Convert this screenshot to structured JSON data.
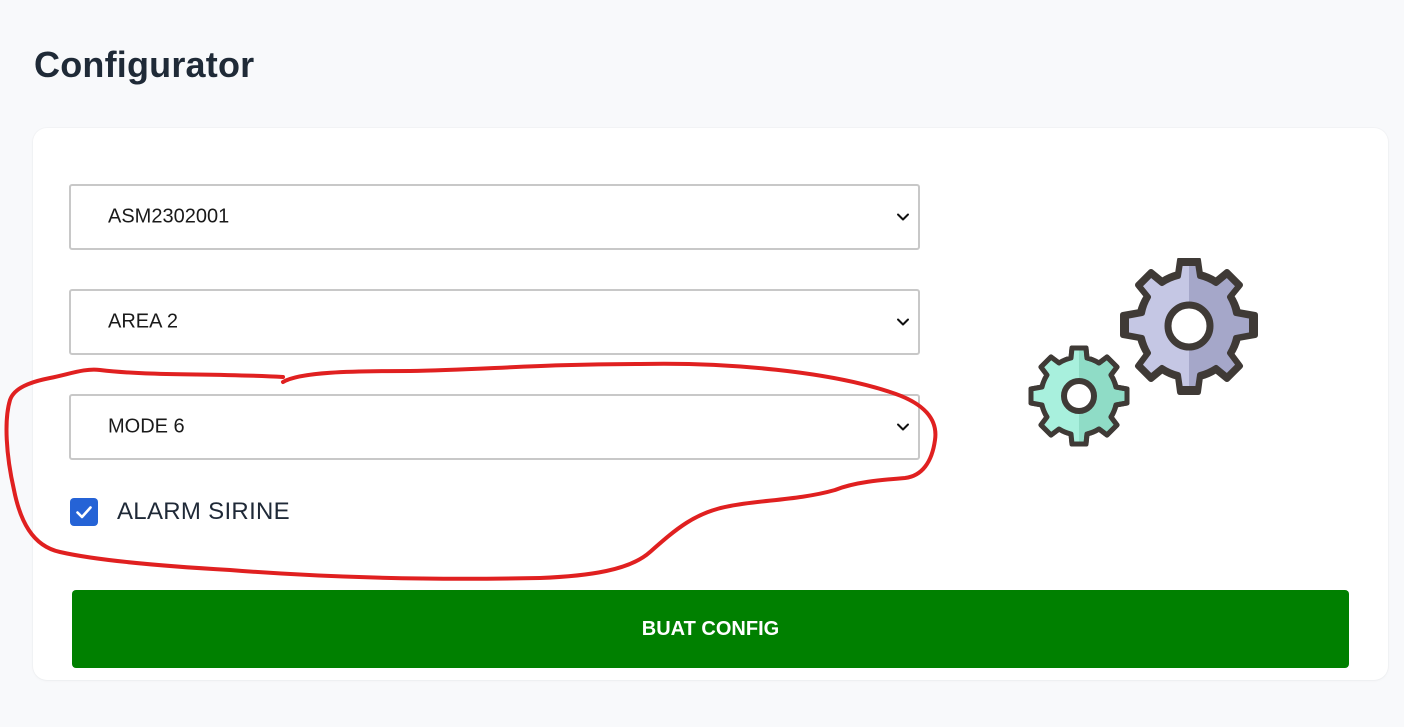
{
  "page": {
    "title": "Configurator"
  },
  "form": {
    "device_select": {
      "value": "ASM2302001"
    },
    "area_select": {
      "value": "AREA 2"
    },
    "mode_select": {
      "value": "MODE 6"
    },
    "alarm_checkbox": {
      "label": "ALARM SIRINE",
      "checked": true
    },
    "submit_label": "BUAT CONFIG"
  },
  "icons": {
    "select_chevron": "chevron-down-icon",
    "checkbox_mark": "check-icon",
    "illustration": "gears-icon"
  },
  "colors": {
    "button_green": "#008000",
    "checkbox_blue": "#2563d6",
    "annotation_red": "#e02020",
    "gear_large": "#c5c7e4",
    "gear_small": "#a8f0dd"
  }
}
